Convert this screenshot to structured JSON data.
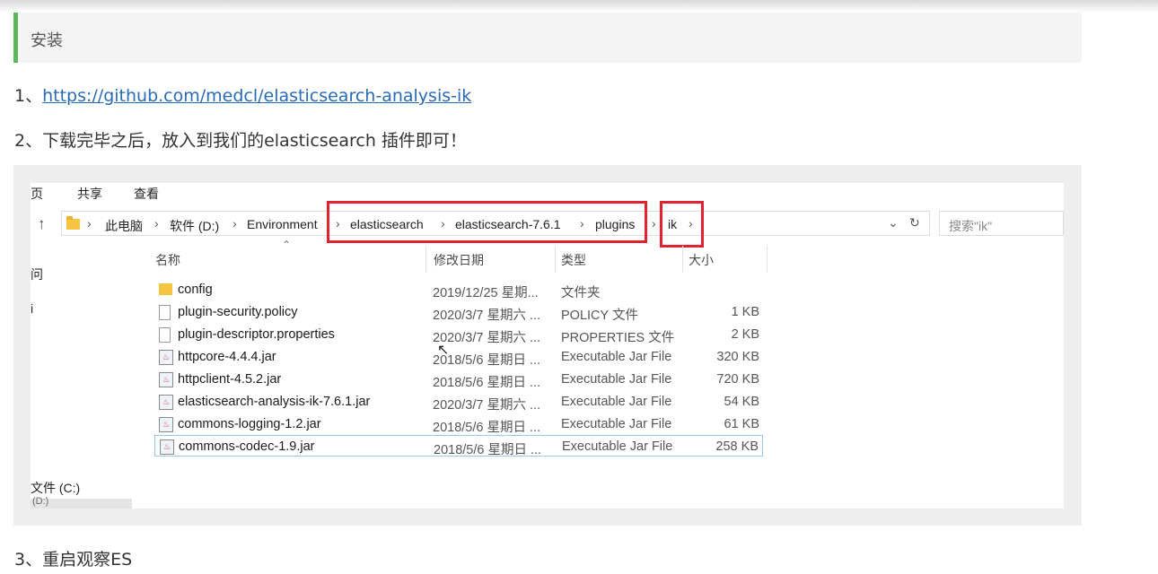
{
  "heading": "安装",
  "steps": {
    "step1_prefix": "1、",
    "step1_link": "https://github.com/medcl/elasticsearch-analysis-ik",
    "step2": "2、下载完毕之后，放入到我们的elasticsearch 插件即可！",
    "step3": "3、重启观察ES"
  },
  "explorer": {
    "ribbon_tabs": [
      "页",
      "共享",
      "查看"
    ],
    "breadcrumb": [
      "此电脑",
      "软件 (D:)",
      "Environment",
      "elasticsearch",
      "elasticsearch-7.6.1",
      "plugins",
      "ik"
    ],
    "search_placeholder": "搜索\"ik\"",
    "columns": {
      "name": "名称",
      "date": "修改日期",
      "type": "类型",
      "size": "大小"
    },
    "nav_items": [
      "问",
      "i",
      "文件 (C:)",
      "(D:)"
    ],
    "highlight_color": "#e0232e",
    "files": [
      {
        "icon": "folder-icon",
        "name": "config",
        "date": "2019/12/25 星期...",
        "type": "文件夹",
        "size": ""
      },
      {
        "icon": "document-icon",
        "name": "plugin-security.policy",
        "date": "2020/3/7 星期六 ...",
        "type": "POLICY 文件",
        "size": "1 KB"
      },
      {
        "icon": "document-icon",
        "name": "plugin-descriptor.properties",
        "date": "2020/3/7 星期六 ...",
        "type": "PROPERTIES 文件",
        "size": "2 KB"
      },
      {
        "icon": "jar-icon",
        "name": "httpcore-4.4.4.jar",
        "date": "2018/5/6 星期日 ...",
        "type": "Executable Jar File",
        "size": "320 KB"
      },
      {
        "icon": "jar-icon",
        "name": "httpclient-4.5.2.jar",
        "date": "2018/5/6 星期日 ...",
        "type": "Executable Jar File",
        "size": "720 KB"
      },
      {
        "icon": "jar-icon",
        "name": "elasticsearch-analysis-ik-7.6.1.jar",
        "date": "2020/3/7 星期六 ...",
        "type": "Executable Jar File",
        "size": "54 KB"
      },
      {
        "icon": "jar-icon",
        "name": "commons-logging-1.2.jar",
        "date": "2018/5/6 星期日 ...",
        "type": "Executable Jar File",
        "size": "61 KB"
      },
      {
        "icon": "jar-icon",
        "name": "commons-codec-1.9.jar",
        "date": "2018/5/6 星期日 ...",
        "type": "Executable Jar File",
        "size": "258 KB"
      }
    ]
  }
}
